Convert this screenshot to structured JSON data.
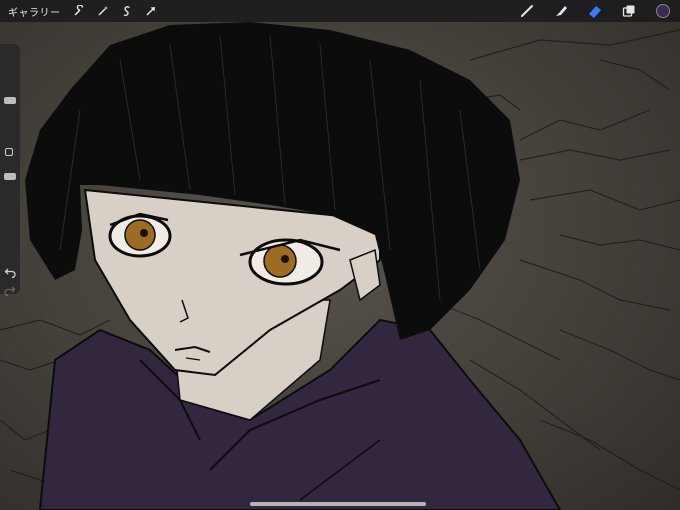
{
  "toolbar": {
    "gallery_label": "ギャラリー",
    "left_tools": [
      {
        "icon": "wrench-icon"
      },
      {
        "icon": "magic-wand-icon"
      },
      {
        "icon": "selection-icon"
      },
      {
        "icon": "transform-arrow-icon"
      }
    ],
    "right_tools": [
      {
        "icon": "brush-icon"
      },
      {
        "icon": "smudge-icon"
      },
      {
        "icon": "eraser-icon",
        "active": true,
        "color": "#3a7bff"
      },
      {
        "icon": "layers-icon"
      }
    ],
    "current_color": "#3b2a52"
  },
  "sidebar": {
    "brush_size": 0.42,
    "brush_opacity": 0.17
  },
  "colors": {
    "hair": "#0c0c0c",
    "skin": "#d8cfc7",
    "iris": "#9c6b24",
    "kimono": "#33263f",
    "background": "#4b463f"
  }
}
